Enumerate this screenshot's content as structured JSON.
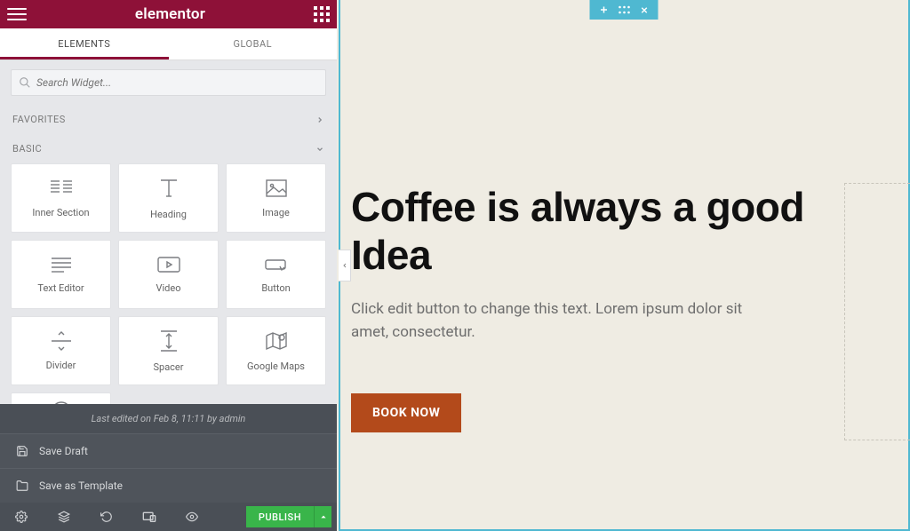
{
  "brand": {
    "logo": "elementor"
  },
  "tabs": {
    "elements": "ELEMENTS",
    "global": "GLOBAL"
  },
  "search": {
    "placeholder": "Search Widget..."
  },
  "sections": {
    "favorites": "FAVORITES",
    "basic": "BASIC"
  },
  "widgets": {
    "inner_section": "Inner Section",
    "heading": "Heading",
    "image": "Image",
    "text_editor": "Text Editor",
    "video": "Video",
    "button": "Button",
    "divider": "Divider",
    "spacer": "Spacer",
    "google_maps": "Google Maps"
  },
  "flyout": {
    "meta": "Last edited on Feb 8, 11:11 by admin",
    "save_draft": "Save Draft",
    "save_template": "Save as Template"
  },
  "footer": {
    "publish": "PUBLISH"
  },
  "canvas": {
    "headline": "Coffee is always a good Idea",
    "subtext": "Click edit button to change this text. Lorem ipsum dolor sit amet, consectetur.",
    "cta": "BOOK NOW"
  },
  "colors": {
    "brand": "#8e1138",
    "accent": "#4fb8d1",
    "cta": "#b34a1b",
    "publish": "#39b54a"
  }
}
